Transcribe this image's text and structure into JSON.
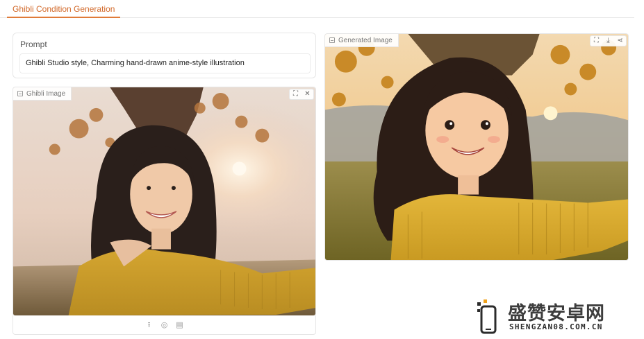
{
  "tabs": [
    {
      "label": "Ghibli Condition Generation",
      "active": true
    }
  ],
  "prompt": {
    "label": "Prompt",
    "value": "Ghibli Studio style, Charming hand-drawn anime-style illustration"
  },
  "input_panel": {
    "label": "Ghibli Image",
    "tools": [
      "fullscreen-icon",
      "close-icon"
    ],
    "bottom_actions": [
      "upload-icon",
      "webcam-icon",
      "clipboard-icon"
    ]
  },
  "output_panel": {
    "label": "Generated Image",
    "tools": [
      "fullscreen-icon",
      "download-icon",
      "share-icon"
    ]
  },
  "watermark": {
    "cn": "盛赞安卓网",
    "en": "SHENGZAN08.COM.CN"
  },
  "colors": {
    "accent": "#e07b39",
    "border": "#e6e6e6",
    "sweater": "#d9a728"
  }
}
